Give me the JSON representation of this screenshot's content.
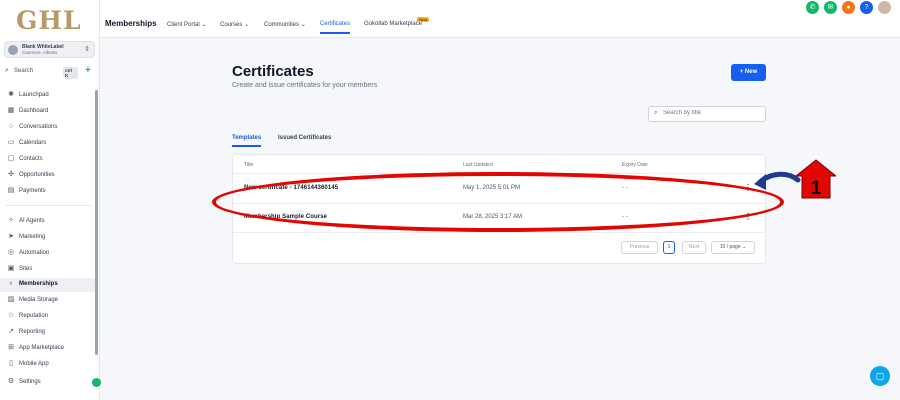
{
  "logo": "GHL",
  "account": {
    "name": "Blank WhiteLabel",
    "location": "Canmore, Alberta"
  },
  "search": {
    "label": "Search",
    "shortcut": "ctrl K"
  },
  "sidebar": {
    "items": [
      {
        "label": "Launchpad",
        "icon": "rocket-icon"
      },
      {
        "label": "Dashboard",
        "icon": "dashboard-icon"
      },
      {
        "label": "Conversations",
        "icon": "chat-icon"
      },
      {
        "label": "Calendars",
        "icon": "calendar-icon"
      },
      {
        "label": "Contacts",
        "icon": "contacts-icon"
      },
      {
        "label": "Opportunities",
        "icon": "opportunities-icon"
      },
      {
        "label": "Payments",
        "icon": "payments-icon"
      },
      {
        "label": "AI Agents",
        "icon": "ai-agents-icon"
      },
      {
        "label": "Marketing",
        "icon": "marketing-icon"
      },
      {
        "label": "Automation",
        "icon": "automation-icon"
      },
      {
        "label": "Sites",
        "icon": "sites-icon"
      },
      {
        "label": "Memberships",
        "icon": "memberships-icon"
      },
      {
        "label": "Media Storage",
        "icon": "media-icon"
      },
      {
        "label": "Reputation",
        "icon": "star-icon"
      },
      {
        "label": "Reporting",
        "icon": "reporting-icon"
      },
      {
        "label": "App Marketplace",
        "icon": "marketplace-icon"
      },
      {
        "label": "Mobile App",
        "icon": "mobile-icon"
      },
      {
        "label": "Settings",
        "icon": "gear-icon"
      }
    ]
  },
  "topbar": {
    "app": "Memberships",
    "nav": [
      "Client Portal",
      "Courses",
      "Communities",
      "Certificates",
      "Gokollab Marketplace"
    ],
    "badge": "New"
  },
  "page": {
    "title": "Certificates",
    "subtitle": "Create and issue certificates for your members",
    "new_button": "+ New",
    "search_placeholder": "Search by title",
    "tabs": [
      "Templates",
      "Issued Certificates"
    ]
  },
  "table": {
    "columns": [
      "Title",
      "Last Updated",
      "Expiry Date"
    ],
    "rows": [
      {
        "title": "New certificate - 1746144360145",
        "updated": "May 1, 2025 5:01 PM",
        "expiry": "- -"
      },
      {
        "title": "Membership Sample Course",
        "updated": "Mar 28, 2025 3:17 AM",
        "expiry": "- -"
      }
    ]
  },
  "pagination": {
    "prev": "Previous",
    "page": "1",
    "next": "Next",
    "per_page": "10 / page"
  },
  "annotation": {
    "number": "1"
  },
  "colors": {
    "primary": "#155eef",
    "annotation": "#e10600",
    "annotation_arrow": "#1f3a93"
  }
}
